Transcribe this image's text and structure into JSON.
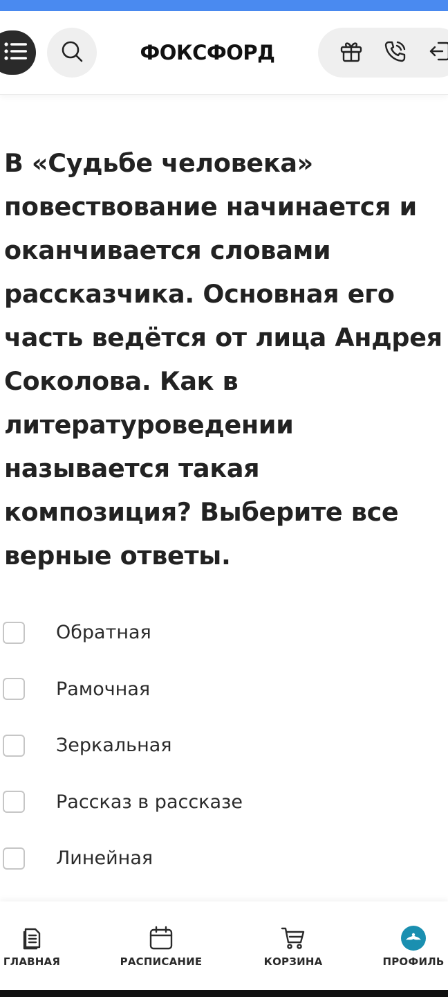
{
  "header": {
    "logo": "ФОКСФОРД",
    "menu_icon": "list-icon",
    "search_icon": "search-icon",
    "actions": [
      {
        "name": "gift-icon"
      },
      {
        "name": "phone-icon"
      },
      {
        "name": "login-icon"
      }
    ]
  },
  "question": {
    "text": "В «Судьбе человека» повествование начинается и оканчивается словами рассказчика. Основная его часть ведётся от лица Андрея Соколова. Как в литературоведении называется такая композиция? Выберите все верные ответы."
  },
  "options": [
    {
      "label": "Обратная",
      "checked": false
    },
    {
      "label": "Рамочная",
      "checked": false
    },
    {
      "label": "Зеркальная",
      "checked": false
    },
    {
      "label": "Рассказ в рассказе",
      "checked": false
    },
    {
      "label": "Линейная",
      "checked": false
    }
  ],
  "bottom_nav": {
    "items": [
      {
        "label": "ГЛАВНАЯ",
        "icon": "document-icon"
      },
      {
        "label": "РАСПИСАНИЕ",
        "icon": "calendar-icon"
      },
      {
        "label": "КОРЗИНА",
        "icon": "cart-icon"
      },
      {
        "label": "ПРОФИЛЬ",
        "icon": "avatar-icon"
      }
    ]
  },
  "colors": {
    "accent_strip": "#4a8af0",
    "profile_avatar": "#1a8fb0"
  }
}
